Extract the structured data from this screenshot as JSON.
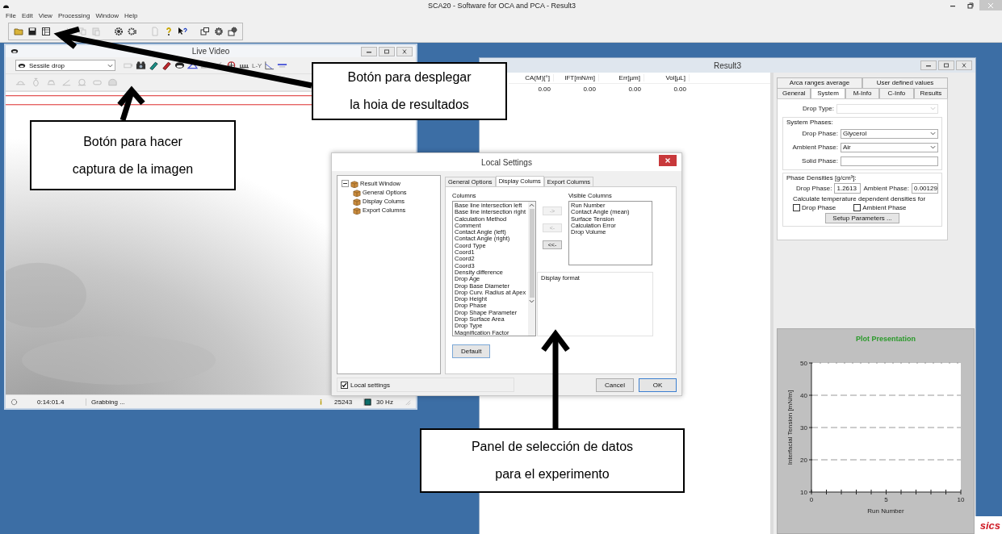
{
  "window": {
    "title": "SCA20 - Software for OCA and PCA - Result3"
  },
  "menu": [
    "File",
    "Edit",
    "View",
    "Processing",
    "Window",
    "Help"
  ],
  "live_video": {
    "title": "Live Video",
    "mode": "Sessile drop",
    "tool_label": "L-Y",
    "status": {
      "time": "0:14:01.4",
      "message": "Grabbing ...",
      "count": "25243",
      "rate": "30 Hz"
    }
  },
  "result_window": {
    "title": "Result3",
    "table": {
      "columns": [
        "CA(M)[°]",
        "IFT[mN/m]",
        "Err[µm]",
        "Vol[µL]"
      ],
      "rows": [
        [
          "0.00",
          "0.00",
          "0.00",
          "0.00"
        ]
      ]
    },
    "tab_rows": [
      {
        "tabs": [
          {
            "label": "Arca ranges average",
            "selected": false
          },
          {
            "label": "User defined values",
            "selected": false
          }
        ]
      },
      {
        "tabs": [
          {
            "label": "General",
            "selected": false
          },
          {
            "label": "System",
            "selected": true
          },
          {
            "label": "M-Info",
            "selected": false
          },
          {
            "label": "C-Info",
            "selected": false
          },
          {
            "label": "Results",
            "selected": false
          }
        ]
      }
    ],
    "drop_type": {
      "label": "Drop Type:",
      "disabled": true
    },
    "system_phases": {
      "title": "System Phases:",
      "fields": [
        {
          "label": "Drop Phase:",
          "kind": "dropdown",
          "value": "Glycerol"
        },
        {
          "label": "Ambient Phase:",
          "kind": "dropdown",
          "value": "Air"
        },
        {
          "label": "Solid Phase:",
          "kind": "text"
        }
      ]
    },
    "phase_densities": {
      "title": "Phase Densities [g/cm³]:",
      "drop_label": "Drop Phase:",
      "drop_value": "1.2613",
      "ambient_label": "Ambient Phase:",
      "ambient_value": "0.00129",
      "note": "Calculate temperature dependent densities for",
      "checkboxes": [
        {
          "label": "Drop Phase",
          "checked": false
        },
        {
          "label": "Ambient Phase",
          "checked": false
        }
      ],
      "button": "Setup Parameters ..."
    },
    "plot": {
      "chart_data": {
        "type": "line",
        "grid": true,
        "title": "Plot Presentation",
        "xlabel": "Run Number",
        "ylabel": "Interfacial Tension [mN/m]",
        "xlim": [
          0,
          10
        ],
        "ylim": [
          10,
          50
        ],
        "xticks": [
          0,
          5,
          10
        ],
        "yticks": [
          10,
          20,
          30,
          40,
          50
        ]
      }
    }
  },
  "dialog": {
    "title": "Local Settings",
    "tree": {
      "label": "Result Window",
      "expanded": true,
      "children": [
        {
          "label": "General Options"
        },
        {
          "label": "Display Colums"
        },
        {
          "label": "Export Columns"
        }
      ]
    },
    "tabs": [
      {
        "label": "General Options",
        "selected": false
      },
      {
        "label": "Display Colums",
        "selected": true
      },
      {
        "label": "Export Columns",
        "selected": false
      }
    ],
    "columns_label": "Columns",
    "columns": [
      "Base line intersection left",
      "Base line intersection right",
      "Calculation Method",
      "Comment",
      "Contact Angle (left)",
      "Contact Angle (right)",
      "Coord Type",
      "Coord1",
      "Coord2",
      "Coord3",
      "Density difference",
      "Drop Age",
      "Drop Base Diameter",
      "Drop Curv. Radius at Apex",
      "Drop Height",
      "Drop Phase",
      "Drop Shape Parameter",
      "Drop Surface Area",
      "Drop Type",
      "Magnification Factor"
    ],
    "move_buttons": [
      {
        "label": "->",
        "disabled": true
      },
      {
        "label": "<-",
        "disabled": true
      },
      {
        "label": "<<-",
        "disabled": false
      }
    ],
    "visible_label": "Visible Columns",
    "visible_columns": [
      "Run Number",
      "Contact Angle (mean)",
      "Surface Tension",
      "Calculation Error",
      "Drop Volume"
    ],
    "display_format_label": "Display format",
    "default_button": "Default",
    "local_settings": {
      "label": "Local settings",
      "checked": true
    },
    "buttons": [
      "Cancel",
      "OK"
    ]
  },
  "callouts": [
    {
      "text": "Botón para desplegar\nla hoia de resultados"
    },
    {
      "text": "Botón para hacer\ncaptura de la imagen"
    },
    {
      "text": "Panel de selección de datos\npara el experimento"
    }
  ],
  "logo": "sics"
}
